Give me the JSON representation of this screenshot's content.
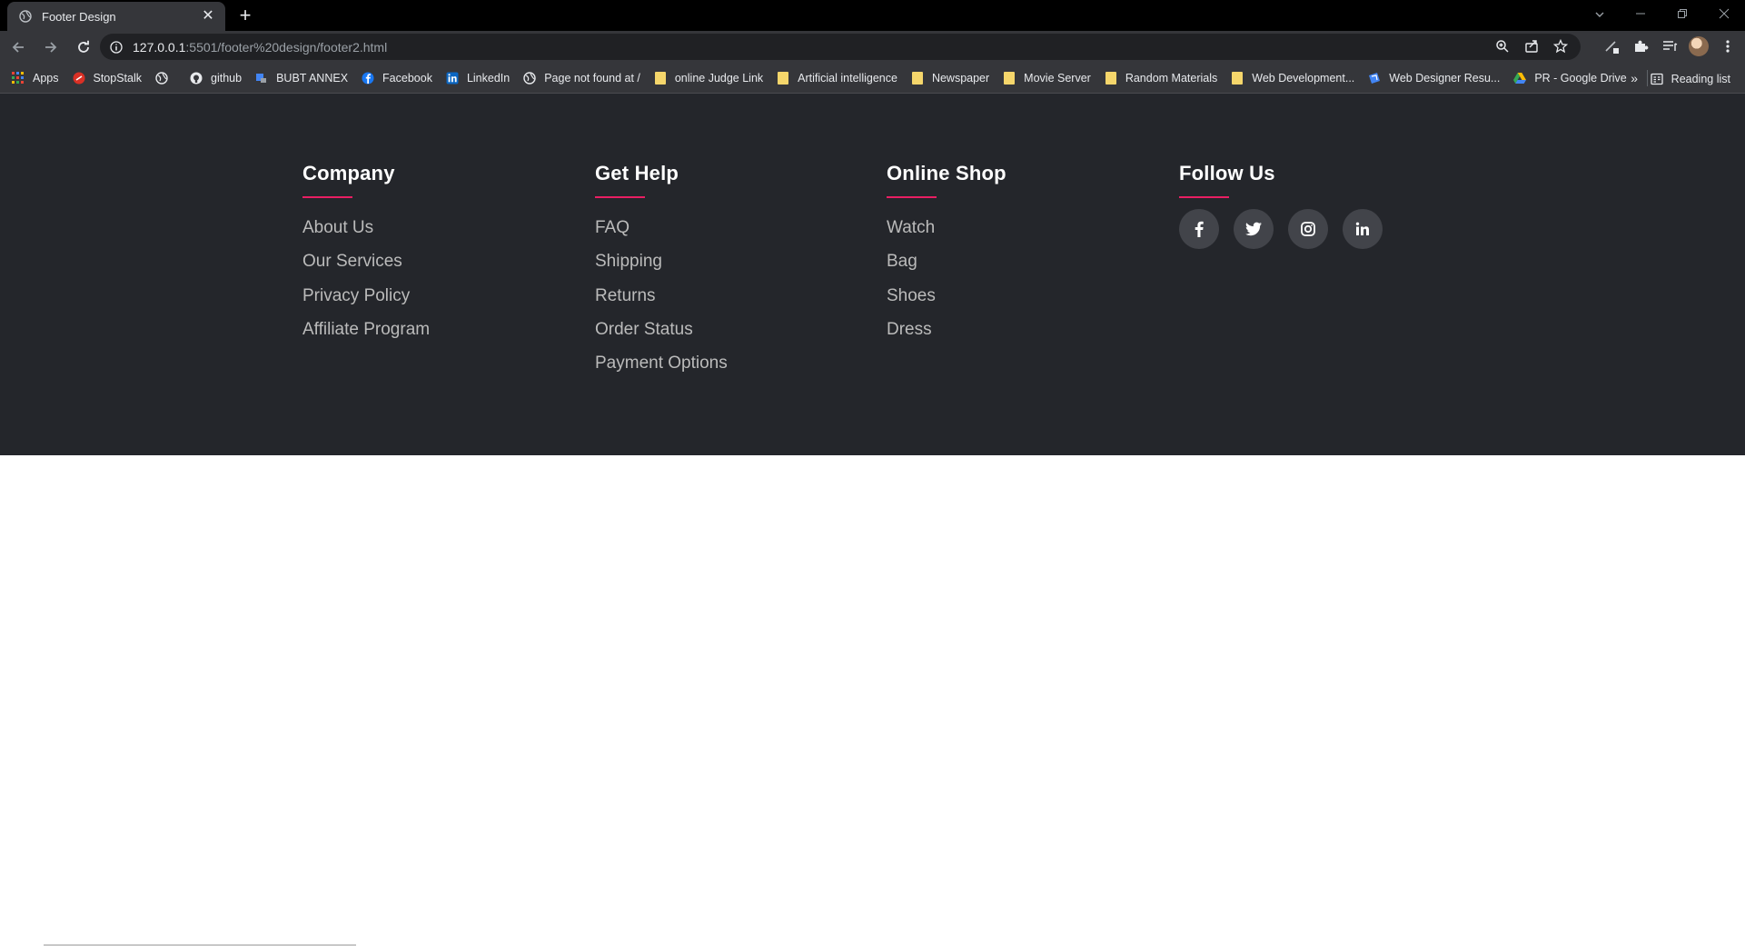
{
  "browser": {
    "tab_title": "Footer Design",
    "tab_close": "✕",
    "new_tab": "+",
    "url_host": "127.0.0.1",
    "url_rest": ":5501/footer%20design/footer2.html",
    "bookmarks": [
      {
        "label": "Apps",
        "icon": "apps-grid-icon"
      },
      {
        "label": "StopStalk",
        "icon": "stopstalk-icon"
      },
      {
        "label": "",
        "icon": "globe-icon"
      },
      {
        "label": "github",
        "icon": "github-icon"
      },
      {
        "label": "BUBT ANNEX",
        "icon": "bubt-icon"
      },
      {
        "label": "Facebook",
        "icon": "facebook-icon"
      },
      {
        "label": "LinkedIn",
        "icon": "linkedin-icon"
      },
      {
        "label": "Page not found at /",
        "icon": "globe-icon"
      },
      {
        "label": "online Judge Link",
        "icon": "folder-icon"
      },
      {
        "label": "Artificial intelligence",
        "icon": "folder-icon"
      },
      {
        "label": "Newspaper",
        "icon": "folder-icon"
      },
      {
        "label": "Movie Server",
        "icon": "folder-icon"
      },
      {
        "label": "Random Materials",
        "icon": "folder-icon"
      },
      {
        "label": "Web Development...",
        "icon": "folder-icon"
      },
      {
        "label": "Web Designer Resu...",
        "icon": "web-designer-icon"
      },
      {
        "label": "PR - Google Drive",
        "icon": "google-drive-icon"
      }
    ],
    "more_bookmarks": "»",
    "reading_list": "Reading list"
  },
  "footer": {
    "columns": [
      {
        "title": "Company",
        "links": [
          "About Us",
          "Our Services",
          "Privacy Policy",
          "Affiliate Program"
        ]
      },
      {
        "title": "Get Help",
        "links": [
          "FAQ",
          "Shipping",
          "Returns",
          "Order Status",
          "Payment Options"
        ]
      },
      {
        "title": "Online Shop",
        "links": [
          "Watch",
          "Bag",
          "Shoes",
          "Dress"
        ]
      },
      {
        "title": "Follow Us",
        "links": []
      }
    ],
    "socials": [
      "facebook-icon",
      "twitter-icon",
      "instagram-icon",
      "linkedin-icon"
    ],
    "accent_color": "#e91e63",
    "background_color": "#24262b"
  }
}
